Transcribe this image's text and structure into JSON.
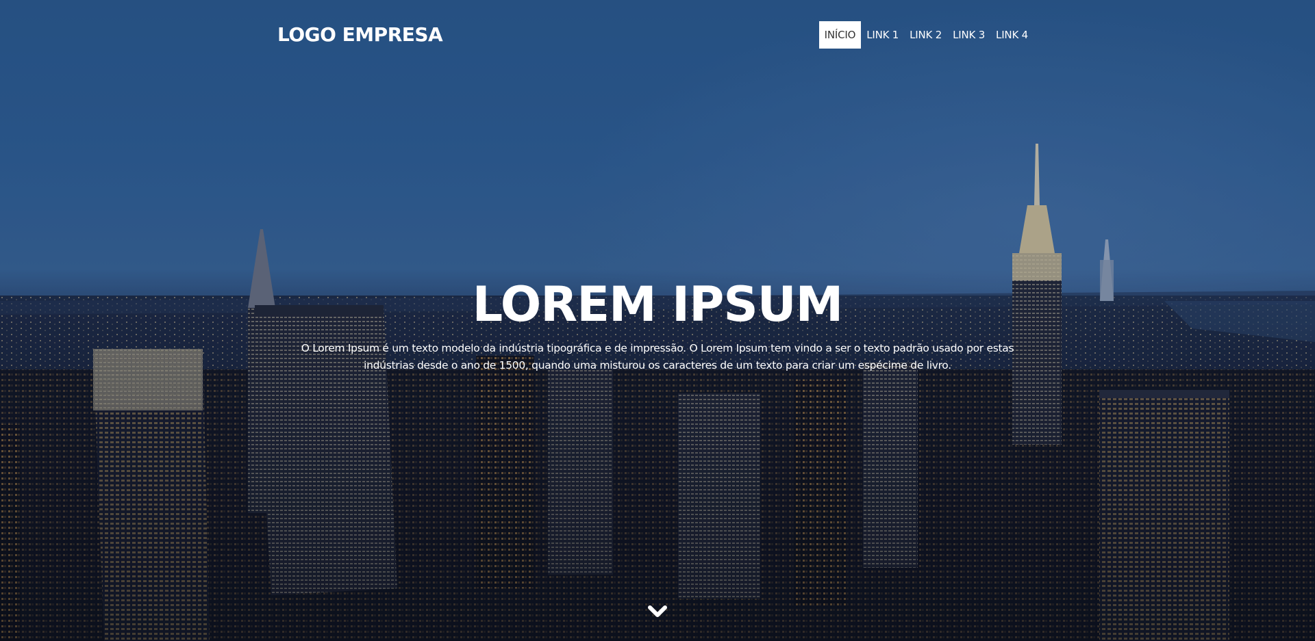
{
  "header": {
    "logo": "LOGO EMPRESA",
    "nav": [
      {
        "label": "INÍCIO",
        "active": true
      },
      {
        "label": "LINK 1",
        "active": false
      },
      {
        "label": "LINK 2",
        "active": false
      },
      {
        "label": "LINK 3",
        "active": false
      },
      {
        "label": "LINK 4",
        "active": false
      }
    ]
  },
  "hero": {
    "title": "LOREM IPSUM",
    "text": "O Lorem Ipsum é um texto modelo da indústria tipográfica e de impressão. O Lorem Ipsum tem vindo a ser o texto padrão usado por estas indústrias desde o ano de 1500, quando uma misturou os caracteres de um texto para criar um espécime de livro.",
    "scroll_icon": "chevron-down-icon"
  },
  "colors": {
    "sky_top": "#2e5f96",
    "sky_horizon": "#3c6a9c",
    "city_dark": "#141a2e",
    "text": "#ffffff",
    "nav_active_bg": "#ffffff",
    "nav_active_text": "#333333"
  }
}
